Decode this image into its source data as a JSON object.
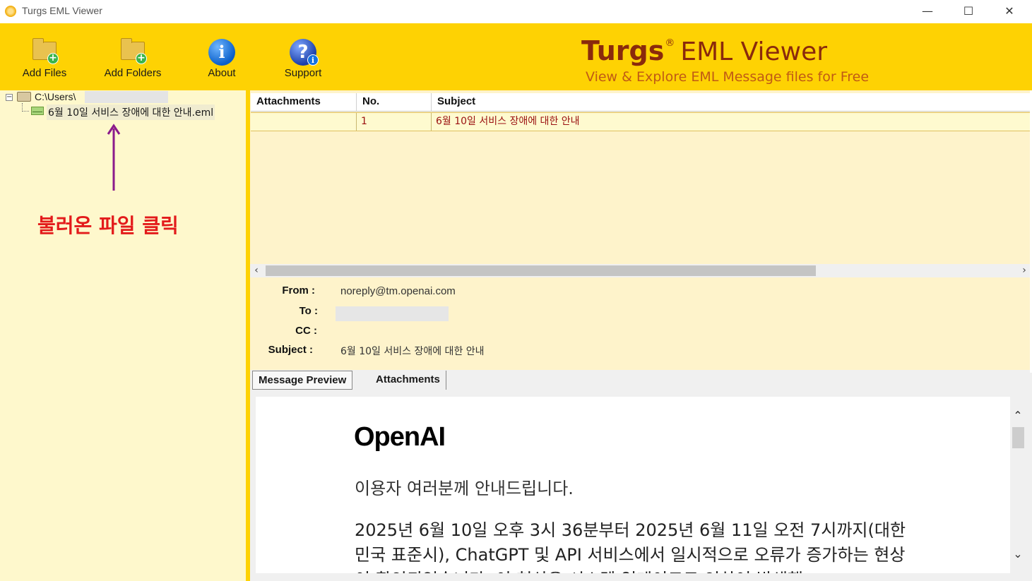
{
  "window": {
    "title": "Turgs EML Viewer",
    "minimize": "—",
    "maximize": "☐",
    "close": "✕"
  },
  "toolbar": {
    "add_files": "Add Files",
    "add_folders": "Add Folders",
    "about": "About",
    "support": "Support"
  },
  "brand": {
    "name": "Turgs",
    "reg": "®",
    "product": "EML Viewer",
    "tagline": "View & Explore EML Message files for Free"
  },
  "tree": {
    "root": "C:\\Users\\",
    "file": "6월 10일 서비스 장애에 대한 안내.eml"
  },
  "annotation": {
    "text": "불러온 파일 클릭",
    "color": "#e31b1b",
    "arrow_color": "#8b1a8b"
  },
  "grid": {
    "columns": [
      "Attachments",
      "No.",
      "Subject"
    ],
    "rows": [
      {
        "attachments": "",
        "no": "1",
        "subject": "6월 10일 서비스 장애에 대한 안내"
      }
    ]
  },
  "details": {
    "from_label": "From :",
    "from_value": "noreply@tm.openai.com",
    "to_label": "To :",
    "to_value": "",
    "cc_label": "CC :",
    "cc_value": "",
    "subject_label": "Subject :",
    "subject_value": "6월 10일 서비스 장애에 대한 안내"
  },
  "tabs": {
    "message_preview": "Message Preview",
    "attachments": "Attachments"
  },
  "preview": {
    "logo": "OpenAI",
    "greeting": "이용자 여러분께 안내드립니다.",
    "body": "2025년 6월 10일 오후 3시 36분부터 2025년 6월 11일 오전 7시까지(대한민국 표준시), ChatGPT 및 API 서비스에서 일시적으로 오류가 증가하는 현상이 확인되었습니다. 이 현상은 시스템 업데이트로 인하여 발생했"
  },
  "colors": {
    "toolbar_bg": "#fed203",
    "pane_bg": "#fef8cc",
    "brand": "#8a2a0c"
  }
}
